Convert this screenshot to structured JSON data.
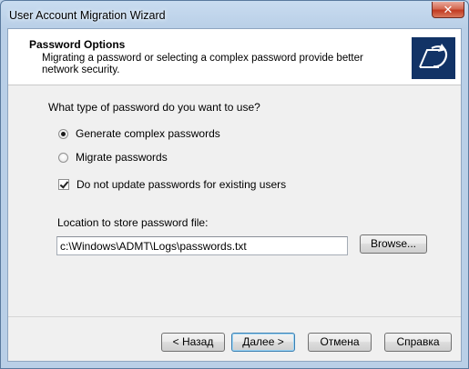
{
  "window": {
    "title": "User Account Migration Wizard",
    "close_glyph": "✕"
  },
  "header": {
    "title": "Password Options",
    "description": "Migrating a password or selecting a complex password provide better network security.",
    "icon": "wizard-arrow-icon"
  },
  "body": {
    "question": "What type of password do you want to use?",
    "options": [
      {
        "label": "Generate complex passwords",
        "selected": true
      },
      {
        "label": "Migrate passwords",
        "selected": false
      }
    ],
    "checkbox": {
      "label": "Do not update passwords for existing users",
      "checked": true
    },
    "location_label": "Location to store password file:",
    "location_value": "c:\\Windows\\ADMT\\Logs\\passwords.txt",
    "browse_label": "Browse..."
  },
  "footer": {
    "back_label": "< Назад",
    "next_label": "Далее >",
    "cancel_label": "Отмена",
    "help_label": "Справка"
  },
  "colors": {
    "title_bar": "#b9cfe7",
    "close_button": "#c23b22",
    "wizard_icon_bg": "#123366",
    "default_button_border": "#3c7fb1"
  }
}
